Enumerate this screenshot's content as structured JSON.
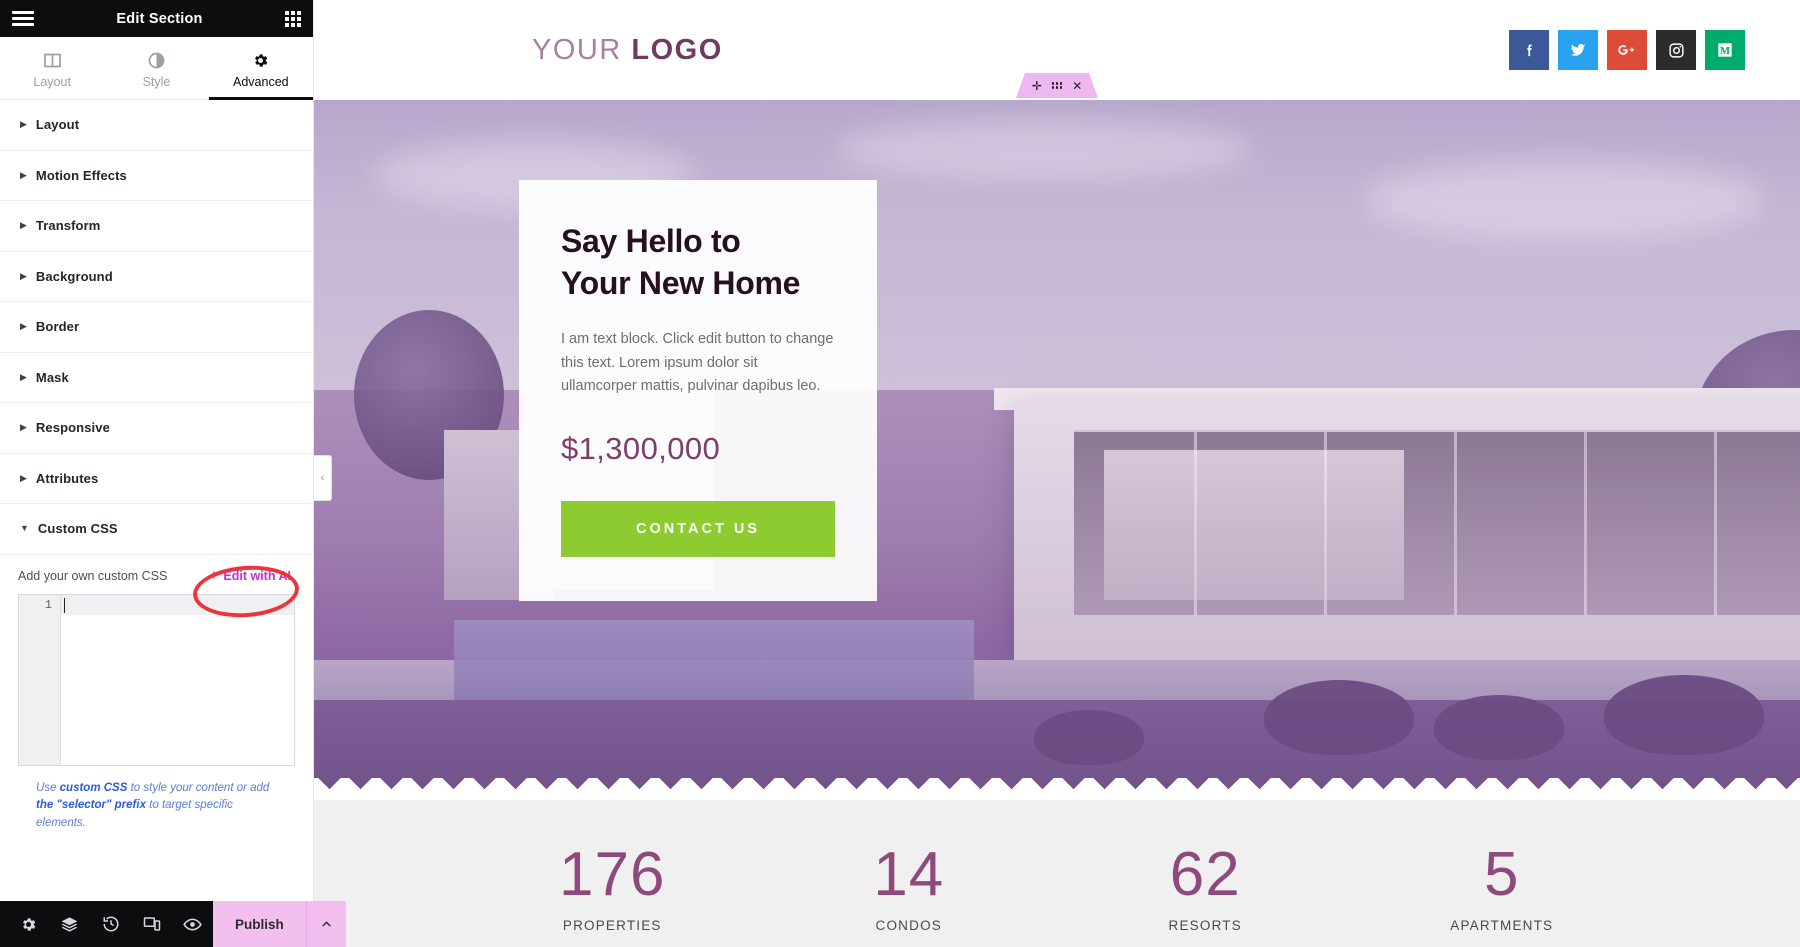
{
  "panel": {
    "header": {
      "title": "Edit Section",
      "menu_icon": "hamburger-icon",
      "grid_icon": "grid-apps-icon"
    },
    "tabs": [
      {
        "label": "Layout",
        "icon": "layout-columns-icon",
        "active": false
      },
      {
        "label": "Style",
        "icon": "contrast-circle-icon",
        "active": false
      },
      {
        "label": "Advanced",
        "icon": "gear-icon",
        "active": true
      }
    ],
    "sections": [
      {
        "label": "Layout",
        "expanded": false
      },
      {
        "label": "Motion Effects",
        "expanded": false
      },
      {
        "label": "Transform",
        "expanded": false
      },
      {
        "label": "Background",
        "expanded": false
      },
      {
        "label": "Border",
        "expanded": false
      },
      {
        "label": "Mask",
        "expanded": false
      },
      {
        "label": "Responsive",
        "expanded": false
      },
      {
        "label": "Attributes",
        "expanded": false
      },
      {
        "label": "Custom CSS",
        "expanded": true
      }
    ],
    "custom_css": {
      "hint": "Add your own custom CSS",
      "ai_button": "Edit with AI",
      "ai_icon": "sparkle-icon",
      "ai_color": "#c42fd6",
      "line_number": "1",
      "code_value": "",
      "note_prefix": "Use ",
      "note_bold1": "custom CSS",
      "note_mid": " to style your content or add ",
      "note_bold2": "the \"selector\" prefix",
      "note_suffix": " to target specific elements."
    },
    "footer": {
      "icons": [
        "gear-icon",
        "layers-icon",
        "history-icon",
        "responsive-device-icon",
        "preview-eye-icon"
      ],
      "publish_label": "Publish",
      "publish_color": "#f3bfee",
      "publish_arrow_icon": "chevron-up-icon"
    },
    "collapse_icon": "chevron-left-icon"
  },
  "canvas": {
    "section_handle": {
      "add_icon": "plus-icon",
      "drag_icon": "six-dots-drag-icon",
      "close_icon": "close-x-icon",
      "color": "#edb8f0"
    },
    "site_header": {
      "logo_thin": "YOUR",
      "logo_bold": "LOGO",
      "socials": [
        {
          "name": "facebook-icon",
          "glyph": "f",
          "color": "#3b5998"
        },
        {
          "name": "twitter-icon",
          "glyph": "t",
          "color": "#29a3ef"
        },
        {
          "name": "google-plus-icon",
          "glyph": "G+",
          "color": "#dd4b39"
        },
        {
          "name": "instagram-icon",
          "glyph": "ig",
          "color": "#2b2b2b"
        },
        {
          "name": "medium-icon",
          "glyph": "M",
          "color": "#00ab6c"
        }
      ]
    },
    "hero": {
      "heading_line1": "Say Hello to",
      "heading_line2": "Your New Home",
      "body": "I am text block. Click edit button to change this text. Lorem ipsum dolor sit ullamcorper mattis, pulvinar dapibus leo.",
      "price": "$1,300,000",
      "cta_label": "CONTACT US",
      "cta_color": "#8ecb31"
    },
    "stats": [
      {
        "number": "176",
        "label": "PROPERTIES"
      },
      {
        "number": "14",
        "label": "CONDOS"
      },
      {
        "number": "62",
        "label": "RESORTS"
      },
      {
        "number": "5",
        "label": "APARTMENTS"
      }
    ]
  }
}
